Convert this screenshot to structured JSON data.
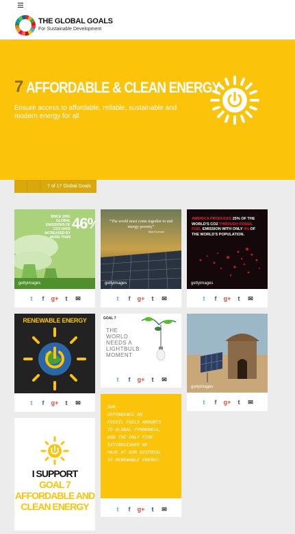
{
  "header": {
    "brand_title": "THE GLOBAL GOALS",
    "brand_subtitle": "For Sustainable Development"
  },
  "hero": {
    "goal_number": "7",
    "title": "AFFORDABLE & CLEAN ENERGY",
    "subtitle": "Ensure access to affordable, reliable, sustainable and modern energy for all"
  },
  "pager": {
    "label": "7 of 17 Global Goals"
  },
  "cards": {
    "c1": {
      "text": "SINCE 1990, GLOBAL EMISSIONS OF CO2 HAVE INCREASED BY MORE THAN",
      "big": "46%"
    },
    "c2": {
      "text": "“The world must come together to end energy poverty”",
      "credit": "Ban Ki-moon"
    },
    "c3": {
      "text_a": "AMERICA PRODUCES",
      "text_b": "25% OF THE WORLD'S CO2",
      "text_c": "THROUGH FOSSIL FUEL",
      "text_d": "EMISSION WITH ONLY",
      "text_e": "4%",
      "text_f": "OF THE WORLD'S POPULATION."
    },
    "c4": {
      "title": "RENEWABLE ENERGY"
    },
    "c5": {
      "tag": "GOAL 7",
      "text": "THE WORLD NEEDS A LIGHTBULB MOMENT"
    },
    "quote": {
      "line1": "OUR",
      "line2": "DEPENDENCE ON",
      "line3": "FOSSIL FUELS AMOUNTS",
      "line4": "TO GLOBAL PYROMANIA,",
      "line5": "AND THE ONLY FIRE",
      "line6": "EXTINGUISHER WE",
      "line7": "HAVE AT OUR DISPOSAL",
      "line8": "IS RENEWABLE ENERGY."
    },
    "support": {
      "line1": "I SUPPORT",
      "line2": "GOAL 7",
      "line3": "AFFORDABLE AND",
      "line4": "CLEAN ENERGY"
    }
  },
  "getty": "gettyimages",
  "share_icons": {
    "twitter": "t",
    "facebook": "f",
    "gplus": "g+",
    "tumblr": "t",
    "email": "✉"
  }
}
